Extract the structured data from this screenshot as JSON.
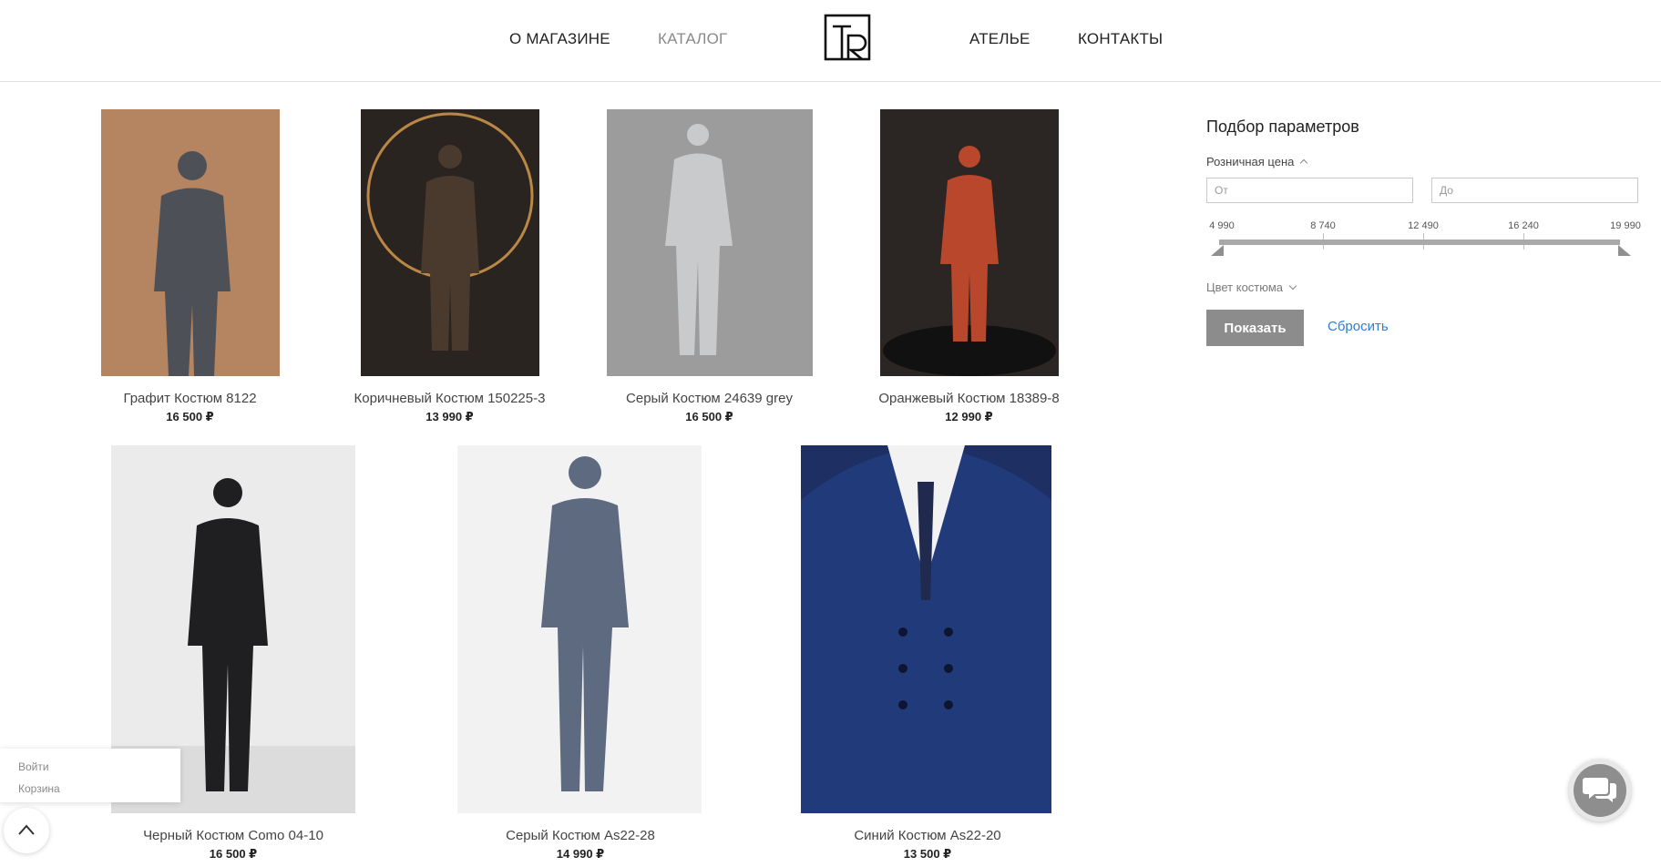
{
  "header": {
    "nav": [
      {
        "label": "О МАГАЗИНЕ"
      },
      {
        "label": "КАТАЛОГ"
      },
      {
        "label": "АТЕЛЬЕ"
      },
      {
        "label": "КОНТАКТЫ"
      }
    ],
    "active_nav": "КАТАЛОГ",
    "logo_icon": "tr-monogram-logo"
  },
  "products": [
    {
      "name": "Графит Костюм 8122",
      "price": "16 500 ₽",
      "bg": "#b58460",
      "suit": "#4d5157"
    },
    {
      "name": "Коричневый Костюм 150225-3",
      "price": "13 990 ₽",
      "bg": "#2a2420",
      "suit": "#4a3a2e"
    },
    {
      "name": "Серый Костюм 24639 grey",
      "price": "16 500 ₽",
      "bg": "#9c9c9c",
      "suit": "#c9cacc"
    },
    {
      "name": "Оранжевый Костюм 18389-8",
      "price": "12 990 ₽",
      "bg": "#2b2624",
      "suit": "#b8472b"
    },
    {
      "name": "Черный Костюм Como 04-10",
      "price": "16 500 ₽",
      "bg": "#ebebeb",
      "suit": "#1f1f22"
    },
    {
      "name": "Серый Костюм As22-28",
      "price": "14 990 ₽",
      "bg": "#f2f2f2",
      "suit": "#5d6a80"
    },
    {
      "name": "Синий Костюм As22-20",
      "price": "13 500 ₽",
      "bg": "#1d2f63",
      "suit": "#203a7a"
    }
  ],
  "filter": {
    "title": "Подбор параметров",
    "price_label": "Розничная цена",
    "from_placeholder": "От",
    "to_placeholder": "До",
    "scale": [
      "4 990",
      "8 740",
      "12 490",
      "16 240",
      "19 990"
    ],
    "color_label": "Цвет костюма",
    "show_button": "Показать",
    "reset_link": "Сбросить"
  },
  "user_popup": {
    "login": "Войти",
    "cart": "Корзина"
  },
  "icons": {
    "scroll_top": "chevron-up-icon",
    "chat": "chat-bubbles-icon"
  }
}
